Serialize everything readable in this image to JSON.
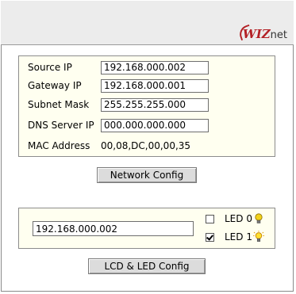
{
  "header": {
    "logo_main": "WIZ",
    "logo_suffix": "net"
  },
  "network": {
    "fields": [
      {
        "label": "Source IP",
        "value": "192.168.000.002"
      },
      {
        "label": "Gateway IP",
        "value": "192.168.000.001"
      },
      {
        "label": "Subnet Mask",
        "value": "255.255.255.000"
      },
      {
        "label": "DNS Server IP",
        "value": "000.000.000.000"
      }
    ],
    "mac_label": "MAC Address",
    "mac_value": "00,08,DC,00,00,35",
    "config_button": "Network Config"
  },
  "lcd": {
    "text_value": "192.168.000.002",
    "leds": [
      {
        "label": "LED 0",
        "checked": false,
        "icon": "bulb-off-icon"
      },
      {
        "label": "LED 1",
        "checked": true,
        "icon": "bulb-on-icon"
      }
    ],
    "config_button": "LCD & LED Config"
  },
  "colors": {
    "panel_background": "#fffff0",
    "header_background": "#ececec",
    "logo_red": "#b32025",
    "bulb_yellow": "#f2d21b"
  }
}
